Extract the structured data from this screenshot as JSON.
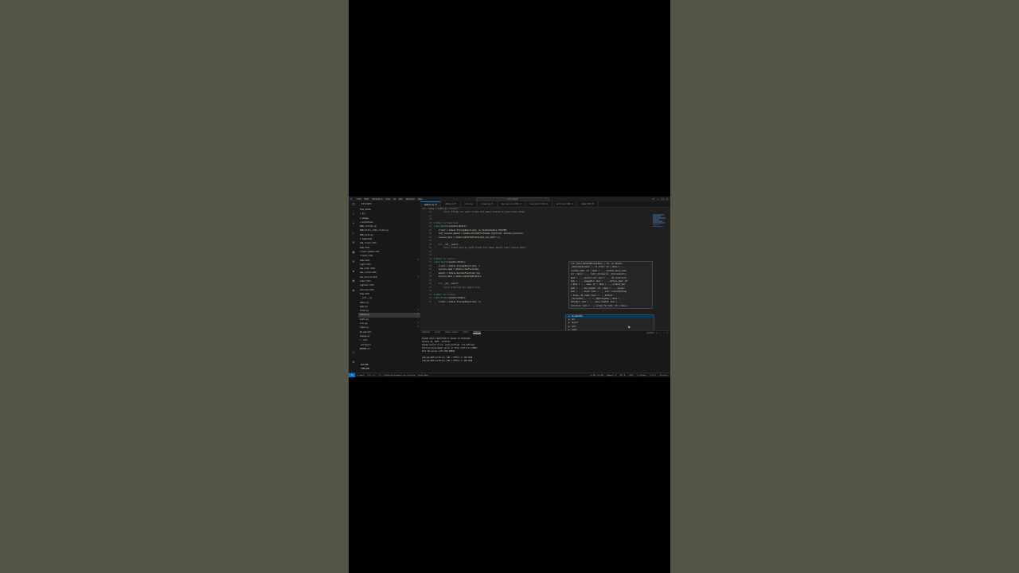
{
  "app": {
    "title": "Full_stack",
    "logo": "vscode-logo"
  },
  "menu": [
    "File",
    "Edit",
    "Selection",
    "View",
    "Go",
    "Run",
    "Terminal",
    "Help"
  ],
  "window_controls": [
    "layout",
    "split",
    "panel",
    "sidebar",
    "minimize",
    "maximize",
    "close"
  ],
  "explorer": {
    "header": "EXPLORER",
    "root": "FULL_STACK",
    "items": [
      {
        "label": "> pyl",
        "badge": ""
      },
      {
        "label": "v webapp",
        "badge": "•"
      },
      {
        "label": "  > migrations",
        "badge": ""
      },
      {
        "label": "    0001_initial.py",
        "badge": ""
      },
      {
        "label": "    0002_alter_order_client.py",
        "badge": ""
      },
      {
        "label": "    0003_auto.py",
        "badge": ""
      },
      {
        "label": "  v templates",
        "badge": "•"
      },
      {
        "label": "    add_client.html",
        "badge": ""
      },
      {
        "label": "    base.html",
        "badge": ""
      },
      {
        "label": "    client_update.html",
        "badge": ""
      },
      {
        "label": "    clients.html",
        "badge": ""
      },
      {
        "label": "    home.html",
        "badge": "M"
      },
      {
        "label": "    login.html",
        "badge": ""
      },
      {
        "label": "    new_order.html",
        "badge": ""
      },
      {
        "label": "    new_client.html",
        "badge": ""
      },
      {
        "label": "    new_service.html",
        "badge": "U"
      },
      {
        "label": "    order.html",
        "badge": ""
      },
      {
        "label": "    register.html",
        "badge": ""
      },
      {
        "label": "    services.html",
        "badge": ""
      },
      {
        "label": "    base.html",
        "badge": ""
      },
      {
        "label": "  __init__.py",
        "badge": ""
      },
      {
        "label": "  admin.py",
        "badge": ""
      },
      {
        "label": "  apps.py",
        "badge": ""
      },
      {
        "label": "  forms.py",
        "badge": "M"
      },
      {
        "label": "  models.py",
        "badge": "M"
      },
      {
        "label": "  tests.py",
        "badge": ""
      },
      {
        "label": "  urls.py",
        "badge": "M"
      },
      {
        "label": "  views.py",
        "badge": "M"
      },
      {
        "label": "  db.sqlite3",
        "badge": ""
      },
      {
        "label": "  manage.py",
        "badge": ""
      },
      {
        "label": "> .venv",
        "badge": ""
      },
      {
        "label": "  .gitignore",
        "badge": ""
      },
      {
        "label": "  README.md",
        "badge": ""
      }
    ],
    "selected_index": 24,
    "outline": "OUTLINE",
    "timeline": "TIMELINE"
  },
  "tabs": [
    {
      "label": "models.py M",
      "active": true
    },
    {
      "label": "admin.py M",
      "active": false
    },
    {
      "label": "urls.py",
      "active": false
    },
    {
      "label": "views.py M",
      "active": false
    },
    {
      "label": "new_service.html U",
      "active": false
    },
    {
      "label": "new_order.html U",
      "active": false
    },
    {
      "label": "services.html U",
      "active": false
    },
    {
      "label": "home.html M",
      "active": false
    }
  ],
  "breadcrumb": "crm > webapp > models.py > Product",
  "code": [
    {
      "ln": "20",
      "html": "        <span class='kw'>return</span> <span class='str'>f\"Order for {self.client.full_name} ordered on {self.order_date}\"</span>"
    },
    {
      "ln": "21",
      "html": ""
    },
    {
      "ln": "22",
      "html": ""
    },
    {
      "ln": "23",
      "html": "<span class='cm'># Model for Rent Paid</span>"
    },
    {
      "ln": "24",
      "html": "<span class='kw'>class</span> <span class='cls'>RentPaid</span>(models.Model):"
    },
    {
      "ln": "25",
      "html": "    client = models.<span class='fn'>ForeignKey</span>(Client, on_delete=models.CASCADE)"
    },
    {
      "ln": "26",
      "html": "    rent_receive_amount = models.<span class='fn'>DecimalField</span>(max_digits=10, decimal_places=2)"
    },
    {
      "ln": "27",
      "html": "    receive_date = models.<span class='fn'>DateTimeField</span>(auto_now_add=<span class='kw'>True</span>)"
    },
    {
      "ln": "28",
      "html": ""
    },
    {
      "ln": "29",
      "html": "    <span class='kw'>def</span> <span class='fn'>__str__</span>(self):"
    },
    {
      "ln": "30",
      "html": "        <span class='kw'>return</span> <span class='str'>f\"Rent paid by {self.client.full_name} amount {self.receive_date}\"</span>"
    },
    {
      "ln": "31",
      "html": ""
    },
    {
      "ln": "32",
      "html": ""
    },
    {
      "ln": "33",
      "html": "<span class='cm'># Model for service</span>"
    },
    {
      "ln": "34",
      "html": "<span class='kw'>class</span> <span class='cls'>Service</span>(models.Model):"
    },
    {
      "ln": "35",
      "html": "    client = models.<span class='fn'>ForeignKey</span>(Client, o"
    },
    {
      "ln": "36",
      "html": "    service_name = models.<span class='fn'>CharField</span>(max_"
    },
    {
      "ln": "37",
      "html": "    amount = models.<span class='fn'>DecimalField</span>(max_dig"
    },
    {
      "ln": "38",
      "html": "    service_date = models.<span class='fn'>DateTimeField</span>(a"
    },
    {
      "ln": "39",
      "html": ""
    },
    {
      "ln": "40",
      "html": "    <span class='kw'>def</span> <span class='fn'>__str__</span>(self):"
    },
    {
      "ln": "41",
      "html": "        <span class='kw'>return</span> <span class='str'>f\"Service for {self.clien</span>"
    },
    {
      "ln": "42",
      "html": ""
    },
    {
      "ln": "43",
      "html": "<span class='cm'># Model for Product</span>"
    },
    {
      "ln": "44",
      "html": "<span class='kw'>class</span> <span class='cls'>Product</span>(models.Model):"
    },
    {
      "ln": "45",
      "html": "    client = models.<span class='fn'>ForeignKey</span>(Client, o|"
    }
  ],
  "hover": [
    "(to: type[_ModelT@ForeignKey] | str, on_delete:",
    "_OnDeleteCallable, *, to_field: str | None = ...,",
    "related_name: str | None = ..., related_query_name:",
    "str | None = ..., limit_choices_to: _ChoicesLimit |",
    "None = ..., parent_link: bool = ..., db_constraint:",
    "bool = ..., swappable: bool = ..., verbose_name: str",
    "| None = ..., name: str | None = ..., primary_key:",
    "bool = ..., max_length: int | None = ..., unique:",
    "bool = ..., blank: bool = ..., null: Literal[False]",
    "= False, db_index: bool = ..., default:",
    "_ForeignKey | ...) -> _M@ForeignKey | None = ...,",
    "editable: bool = ..., auto_created: bool = ...,",
    "serialize: bool = ..., unique_for_date: str | None ="
  ],
  "suggestions": [
    {
      "sym": "▣",
      "label": "on_delete=",
      "selected": true
    },
    {
      "sym": "▣",
      "label": "str",
      "selected": false
    },
    {
      "sym": "▣",
      "label": "object",
      "selected": false
    },
    {
      "sym": "▣",
      "label": "self",
      "selected": false
    },
    {
      "sym": "▣",
      "label": "super",
      "selected": false
    },
    {
      "sym": "▣",
      "label": "and",
      "selected": false
    },
    {
      "sym": "▣",
      "label": "as",
      "selected": false
    },
    {
      "sym": "▣",
      "label": "break",
      "selected": false
    },
    {
      "sym": "▣",
      "label": "ArithmeticError",
      "selected": false
    }
  ],
  "panel": {
    "tabs": [
      "PROBLEMS",
      "OUTPUT",
      "DEBUG CONSOLE",
      "PORTS",
      "TERMINAL"
    ],
    "active": 4,
    "controls": [
      "python",
      "+",
      "⌄",
      "⋯",
      "×"
    ],
    "lines": [
      "System check identified no issues (0 silenced).",
      "January 26, 2025 - 16:05:31",
      "Django version 5.1.5, using settings 'crm.settings'",
      "Starting development server at http://127.0.0.1:8000/",
      "Quit the server with CTRL-BREAK.",
      "",
      "[26/Jan/2025 16:05:41] \"GET / HTTP/1.1\" 200 3559",
      "[26/Jan/2025 16:05:41] \"GET / HTTP/1.1\" 200 3559"
    ]
  },
  "status": {
    "remote": "⇆",
    "left": [
      "⎇ main*",
      "⊗ 0 ⚠ 0",
      "⚡ 0",
      "Python Environment not selected",
      "Quick Open"
    ],
    "right": [
      "Ln 45, Col 40",
      "Spaces: 4",
      "UTF-8",
      "CRLF",
      "{} Python",
      "3.13.1",
      "Prettier"
    ]
  }
}
